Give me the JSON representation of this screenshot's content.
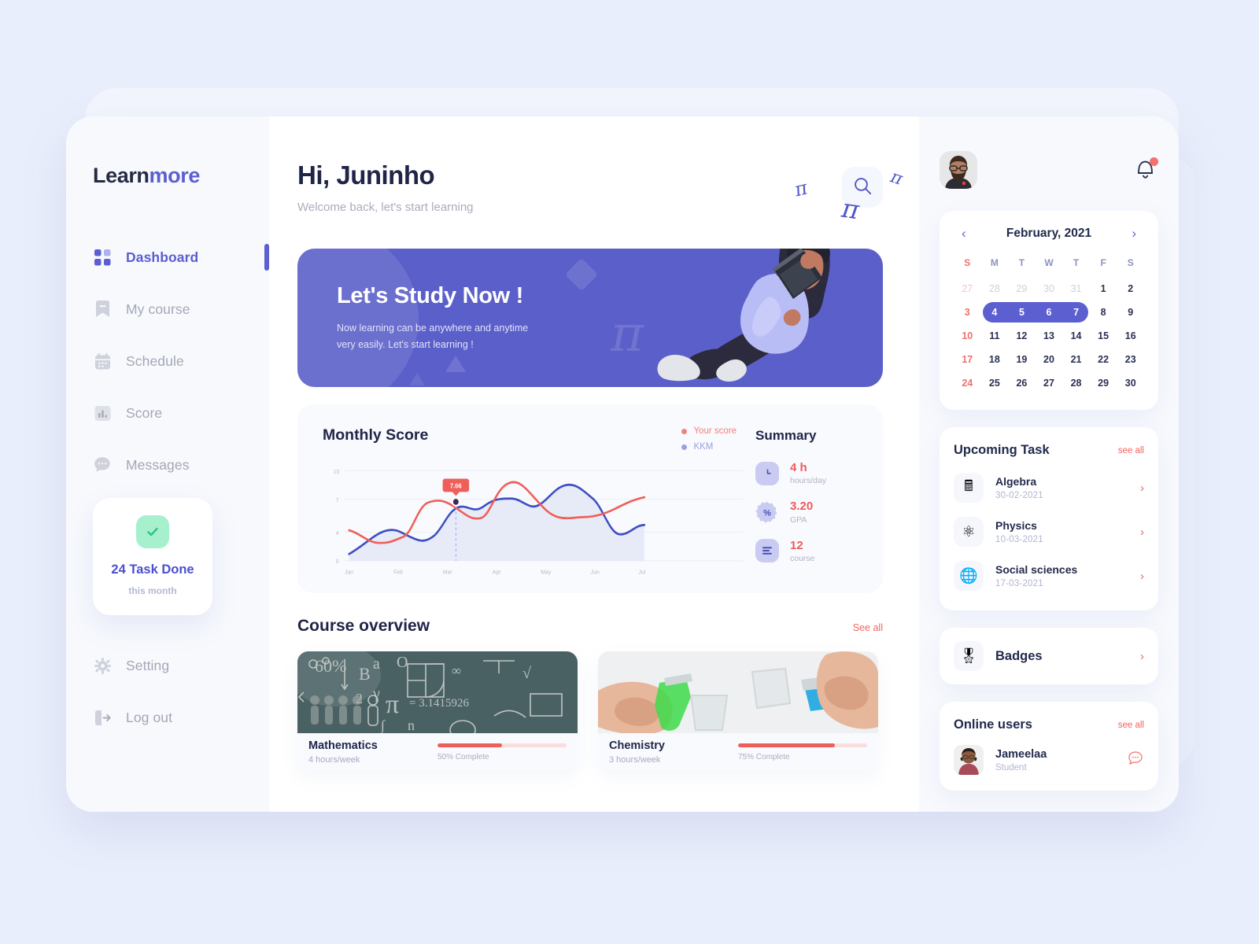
{
  "brand": {
    "first": "Learn",
    "second": "more"
  },
  "sidebar": {
    "items": [
      {
        "label": "Dashboard",
        "icon": "grid-icon",
        "active": true
      },
      {
        "label": "My course",
        "icon": "bookmark-icon",
        "active": false
      },
      {
        "label": "Schedule",
        "icon": "calendar-icon",
        "active": false
      },
      {
        "label": "Score",
        "icon": "bar-chart-icon",
        "active": false
      },
      {
        "label": "Messages",
        "icon": "chat-icon",
        "active": false
      }
    ],
    "task_card": {
      "title": "24 Task Done",
      "subtitle": "this month",
      "icon": "check-icon"
    },
    "bottom": [
      {
        "label": "Setting",
        "icon": "gear-icon"
      },
      {
        "label": "Log out",
        "icon": "logout-icon"
      }
    ]
  },
  "header": {
    "greeting": "Hi, Juninho",
    "subtitle": "Welcome back, let's start learning",
    "search_icon": "search-icon",
    "pi_symbols": [
      "π",
      "π",
      "π"
    ]
  },
  "banner": {
    "title": "Let's Study Now  !",
    "line1": "Now learning can be anywhere and anytime",
    "line2": "very easily. Let's start learning !",
    "bg_color": "#5b5fc9"
  },
  "score": {
    "title": "Monthly Score",
    "legend": [
      {
        "label": "Your score",
        "color": "#f0827c"
      },
      {
        "label": "KKM",
        "color": "#9aa0e0"
      }
    ],
    "summary_title": "Summary",
    "summary": [
      {
        "value": "4 h",
        "unit": "hours/day",
        "icon": "clock-icon"
      },
      {
        "value": "3.20",
        "unit": "GPA",
        "icon": "percent-badge-icon"
      },
      {
        "value": "12",
        "unit": "course",
        "icon": "list-icon"
      }
    ]
  },
  "chart_data": {
    "type": "line",
    "title": "Monthly Score",
    "xlabel": "",
    "ylabel": "",
    "categories": [
      "Jan",
      "Feb",
      "Mar",
      "Apr",
      "May",
      "Jun",
      "Jul"
    ],
    "yticks": [
      0,
      4,
      7,
      10
    ],
    "ylim": [
      0,
      10
    ],
    "grid": true,
    "legend_position": "top-right",
    "annotation": {
      "label": "7.66",
      "series": "KKM",
      "x": "mid-Mar",
      "y": 7.66
    },
    "series": [
      {
        "name": "Your score",
        "color": "#ef5f59",
        "values": [
          4.4,
          3.0,
          2.9,
          3.3,
          5.3,
          7.4,
          7.2,
          6.4,
          5.6,
          6.3,
          9.3,
          8.6,
          7.6,
          6.8,
          6.3,
          6.2,
          6.5,
          7.4,
          8.0
        ]
      },
      {
        "name": "KKM",
        "color": "#3f4fc0",
        "fill": "#e7eaf8",
        "values": [
          0.7,
          2.3,
          3.7,
          3.4,
          2.7,
          2.6,
          4.5,
          4.9,
          6.0,
          7.8,
          7.7,
          7.7,
          6.5,
          7.9,
          9.0,
          8.9,
          7.0,
          4.0,
          4.9
        ]
      }
    ]
  },
  "course_overview": {
    "title": "Course overview",
    "see_all": "See all",
    "courses": [
      {
        "name": "Mathematics",
        "hours": "4 hours/week",
        "progress_label": "50% Complete",
        "progress": 50,
        "image": "chalkboard-math"
      },
      {
        "name": "Chemistry",
        "hours": "3 hours/week",
        "progress_label": "75% Complete",
        "progress": 75,
        "image": "lab-beakers"
      }
    ]
  },
  "right": {
    "avatar": "user-avatar",
    "bell_icon": "bell-icon",
    "calendar": {
      "month": "February, 2021",
      "prev": "‹",
      "next": "›",
      "dow": [
        "S",
        "M",
        "T",
        "W",
        "T",
        "F",
        "S"
      ],
      "weeks": [
        [
          {
            "d": "27",
            "muted": true
          },
          {
            "d": "28",
            "muted": true
          },
          {
            "d": "29",
            "muted": true
          },
          {
            "d": "30",
            "muted": true
          },
          {
            "d": "31",
            "muted": true
          },
          {
            "d": "1"
          },
          {
            "d": "2"
          }
        ],
        [
          {
            "d": "3"
          },
          {
            "d": "4",
            "sel": "first"
          },
          {
            "d": "5",
            "sel": "mid"
          },
          {
            "d": "6",
            "sel": "mid"
          },
          {
            "d": "7",
            "sel": "last"
          },
          {
            "d": "8"
          },
          {
            "d": "9"
          }
        ],
        [
          {
            "d": "10"
          },
          {
            "d": "11"
          },
          {
            "d": "12"
          },
          {
            "d": "13"
          },
          {
            "d": "14"
          },
          {
            "d": "15"
          },
          {
            "d": "16"
          }
        ],
        [
          {
            "d": "17"
          },
          {
            "d": "18"
          },
          {
            "d": "19"
          },
          {
            "d": "20"
          },
          {
            "d": "21"
          },
          {
            "d": "22"
          },
          {
            "d": "23"
          }
        ],
        [
          {
            "d": "24"
          },
          {
            "d": "25"
          },
          {
            "d": "26"
          },
          {
            "d": "27"
          },
          {
            "d": "28"
          },
          {
            "d": "29"
          },
          {
            "d": "30"
          }
        ]
      ]
    },
    "upcoming": {
      "title": "Upcoming Task",
      "see_all": "see all",
      "tasks": [
        {
          "name": "Algebra",
          "date": "30-02-2021",
          "icon": "calculator-icon"
        },
        {
          "name": "Physics",
          "date": "10-03-2021",
          "icon": "atom-icon"
        },
        {
          "name": "Social sciences",
          "date": "17-03-2021",
          "icon": "globe-icon"
        }
      ]
    },
    "badges": {
      "title": "Badges",
      "icon": "medal-icon"
    },
    "online": {
      "title": "Online users",
      "see_all": "see all",
      "users": [
        {
          "name": "Jameelaa",
          "role": "Student",
          "avatar": "female-avatar",
          "action_icon": "message-icon"
        }
      ]
    }
  }
}
